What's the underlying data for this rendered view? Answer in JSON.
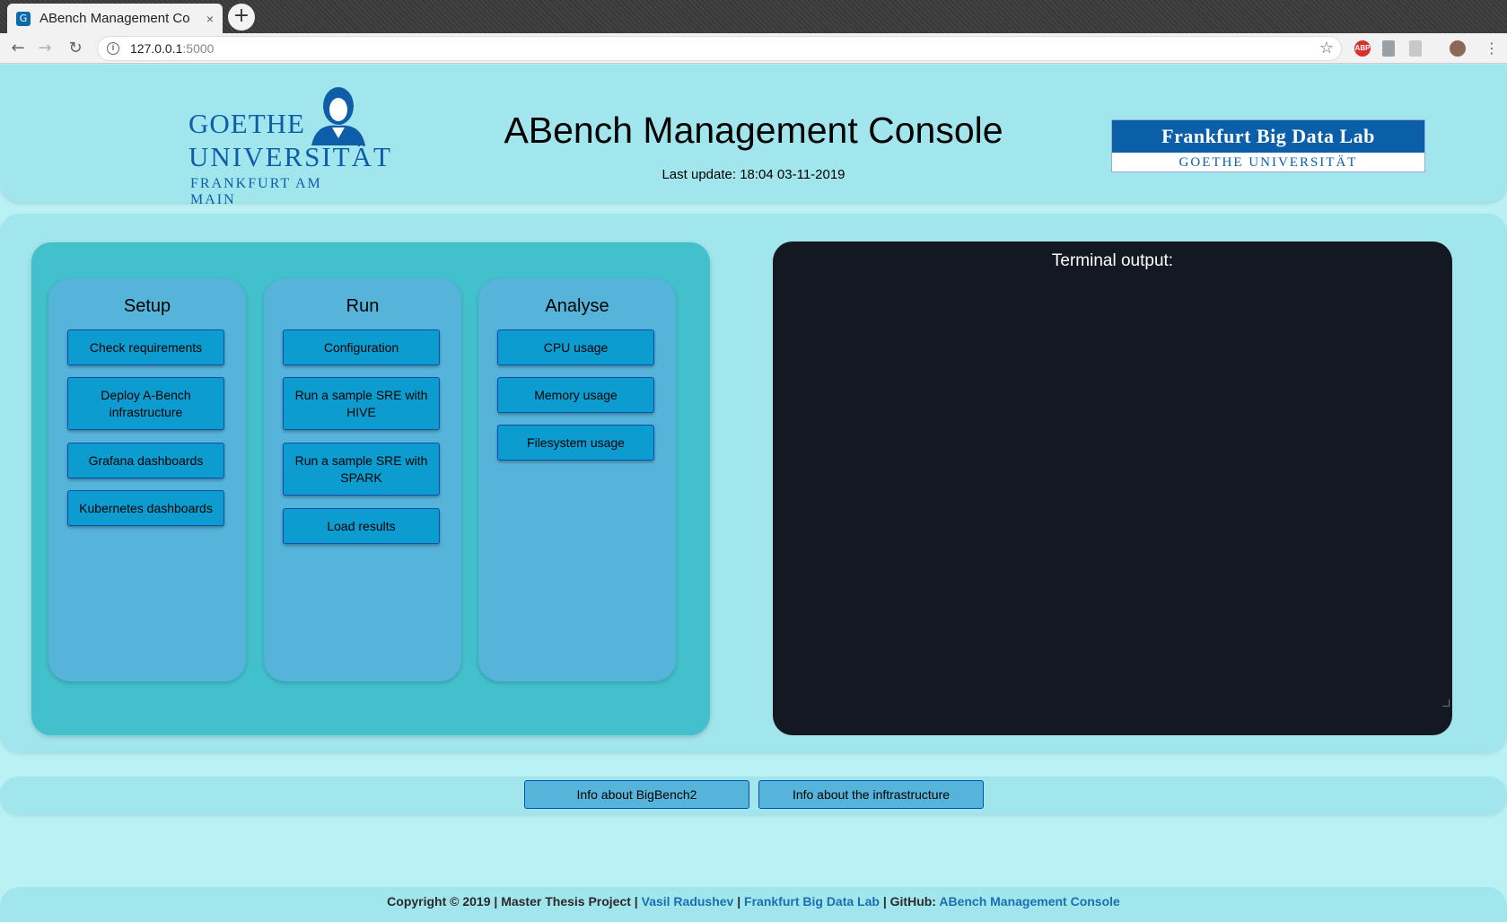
{
  "browser": {
    "tab_title": "ABench Management Co",
    "tab_close": "×",
    "new_tab": "+",
    "url_host": "127.0.0.1",
    "url_port": ":5000"
  },
  "header": {
    "logo_line1": "GOETHE",
    "logo_line2": "UNIVERSITÄT",
    "logo_line3": "FRANKFURT AM MAIN",
    "title": "ABench Management Console",
    "last_update": "Last update: 18:04 03-11-2019",
    "fbdl_title": "Frankfurt Big Data Lab",
    "fbdl_subtitle": "GOETHE UNIVERSITÄT"
  },
  "columns": [
    {
      "title": "Setup",
      "buttons": [
        "Check requirements",
        "Deploy A-Bench infrastructure",
        "Grafana dashboards",
        "Kubernetes dashboards"
      ]
    },
    {
      "title": "Run",
      "buttons": [
        "Configuration",
        "Run a sample SRE with HIVE",
        "Run a sample SRE with SPARK",
        "Load results"
      ]
    },
    {
      "title": "Analyse",
      "buttons": [
        "CPU usage",
        "Memory usage",
        "Filesystem usage"
      ]
    }
  ],
  "terminal": {
    "label": "Terminal output:"
  },
  "info": {
    "bigbench_button": "Info about BigBench2",
    "infra_button": "Info about the inftrastructure"
  },
  "footer": {
    "prefix": "Copyright © 2019 | Master Thesis Project | ",
    "author": "Vasil Radushev",
    "sep1": " | ",
    "lab": "Frankfurt Big Data Lab",
    "sep2": " | GitHub: ",
    "repo": "ABench Management Console"
  },
  "colors": {
    "page_bg": "#b9f1f5",
    "band_bg": "#a2e6ed",
    "panel_bg": "#42c0cb",
    "column_bg": "#56b4da",
    "button_bg": "#0c9cd0",
    "terminal_bg": "#131822",
    "link": "#1a6fb0"
  }
}
